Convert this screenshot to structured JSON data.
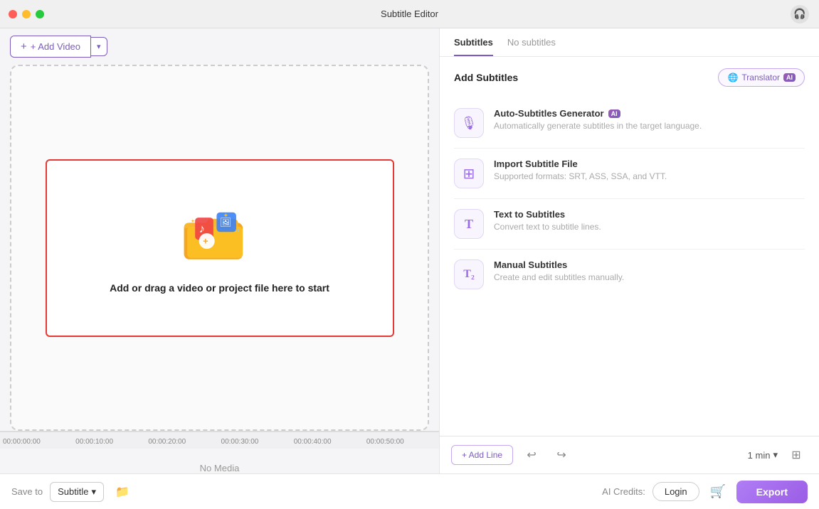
{
  "titlebar": {
    "title": "Subtitle Editor",
    "icon": "🎧"
  },
  "left": {
    "add_video_label": "+ Add Video",
    "drop_area_text": "Add or drag a video or project file here to start",
    "timeline_marks": [
      "00:00:00:00",
      "00:00:10:00",
      "00:00:20:00",
      "00:00:30:00",
      "00:00:40:00",
      "00:00:50:00"
    ],
    "no_media": "No Media"
  },
  "right": {
    "tabs": [
      {
        "label": "Subtitles",
        "active": true
      },
      {
        "label": "No subtitles",
        "active": false
      }
    ],
    "add_subtitles_title": "Add Subtitles",
    "translator_label": "Translator",
    "options": [
      {
        "title": "Auto-Subtitles Generator",
        "desc": "Automatically generate subtitles in the target language.",
        "has_ai": true,
        "icon": "🎙"
      },
      {
        "title": "Import Subtitle File",
        "desc": "Supported formats: SRT, ASS, SSA, and VTT.",
        "has_ai": false,
        "icon": "＋"
      },
      {
        "title": "Text to Subtitles",
        "desc": "Convert text to subtitle lines.",
        "has_ai": false,
        "icon": "T"
      },
      {
        "title": "Manual Subtitles",
        "desc": "Create and edit subtitles manually.",
        "has_ai": false,
        "icon": "T₂"
      }
    ],
    "add_line_label": "+ Add Line",
    "duration_label": "1 min"
  },
  "bottom": {
    "save_to_label": "Save to",
    "subtitle_select": "Subtitle",
    "ai_credits_label": "AI Credits:",
    "login_label": "Login",
    "export_label": "Export"
  }
}
